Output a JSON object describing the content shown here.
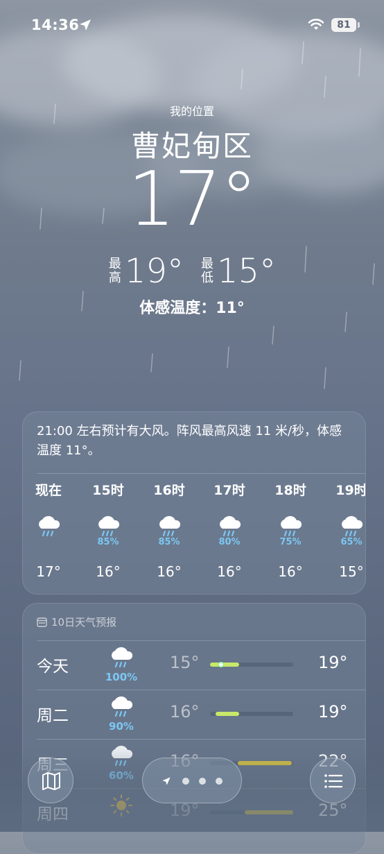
{
  "status_bar": {
    "time": "14:36",
    "battery": "81"
  },
  "header": {
    "my_location": "我的位置",
    "city": "曹妃甸区",
    "temperature": "17°",
    "high_label": "最高",
    "high": "19°",
    "low_label": "最低",
    "low": "15°",
    "feels_like": "体感温度：11°"
  },
  "hourly": {
    "alert": "21:00 左右预计有大风。阵风最高风速 11 米/秒，体感温度 11°。",
    "hours": [
      {
        "label": "现在",
        "icon": "rain-cloud-icon",
        "precip": "",
        "temp": "17°"
      },
      {
        "label": "15时",
        "icon": "rain-cloud-icon",
        "precip": "85%",
        "temp": "16°"
      },
      {
        "label": "16时",
        "icon": "rain-cloud-icon",
        "precip": "85%",
        "temp": "16°"
      },
      {
        "label": "17时",
        "icon": "rain-cloud-icon",
        "precip": "80%",
        "temp": "16°"
      },
      {
        "label": "18时",
        "icon": "rain-cloud-icon",
        "precip": "75%",
        "temp": "16°"
      },
      {
        "label": "19时",
        "icon": "rain-cloud-icon",
        "precip": "65%",
        "temp": "15°"
      }
    ]
  },
  "daily": {
    "title": "10日天气预报",
    "days": [
      {
        "name": "今天",
        "icon": "rain-cloud-icon",
        "precip": "100%",
        "low": "15°",
        "high": "19°"
      },
      {
        "name": "周二",
        "icon": "rain-cloud-icon",
        "precip": "90%",
        "low": "16°",
        "high": "19°"
      },
      {
        "name": "周三",
        "icon": "rain-cloud-icon",
        "precip": "60%",
        "low": "16°",
        "high": "22°"
      },
      {
        "name": "周四",
        "icon": "sun-icon",
        "precip": "",
        "low": "19°",
        "high": "25°"
      }
    ]
  },
  "colors": {
    "precip": "#7cc7f2",
    "bar_green": "#c8e86a",
    "bar_yellow": "#d8c23c"
  }
}
